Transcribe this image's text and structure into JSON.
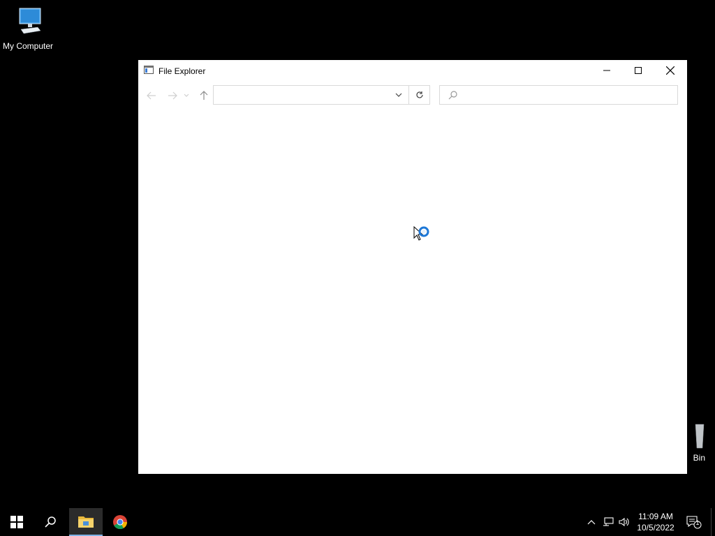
{
  "desktop": {
    "icons": [
      {
        "label": "My Computer"
      },
      {
        "label": "Bin"
      }
    ]
  },
  "window": {
    "title": "File Explorer",
    "address": {
      "value": ""
    },
    "search": {
      "placeholder": ""
    }
  },
  "taskbar": {
    "clock": {
      "time": "11:09 AM",
      "date": "10/5/2022"
    },
    "notification_count": "1"
  },
  "colors": {
    "desktop_bg": "#000000",
    "taskbar_bg": "#000000",
    "active_indicator": "#7fb2e6",
    "window_bg": "#ffffff"
  }
}
